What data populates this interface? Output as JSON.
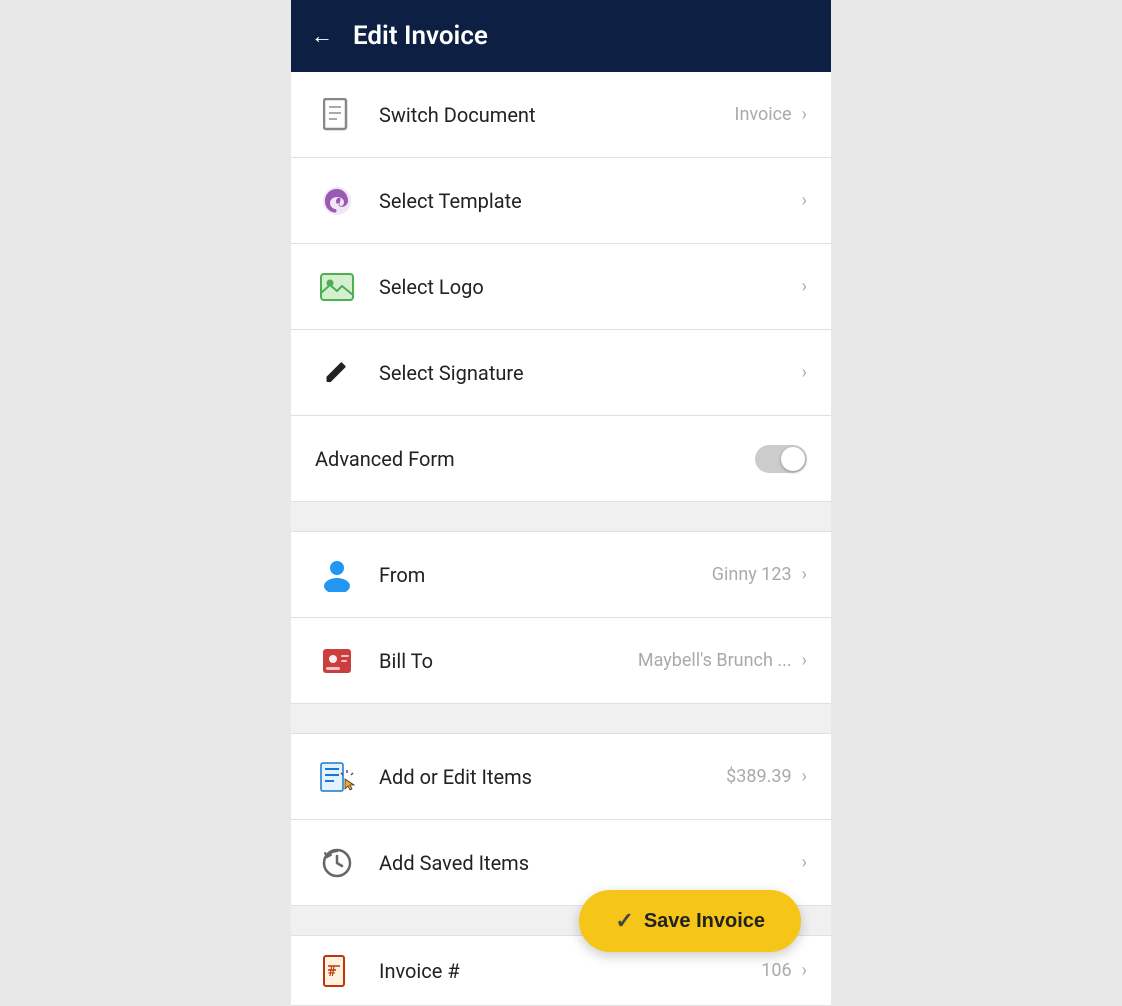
{
  "header": {
    "title": "Edit Invoice",
    "back_label": "←"
  },
  "menu_items": [
    {
      "id": "switch-document",
      "label": "Switch Document",
      "value": "Invoice",
      "icon": "document-icon",
      "has_chevron": true
    },
    {
      "id": "select-template",
      "label": "Select Template",
      "value": "",
      "icon": "palette-icon",
      "has_chevron": true
    },
    {
      "id": "select-logo",
      "label": "Select Logo",
      "value": "",
      "icon": "image-icon",
      "has_chevron": true
    },
    {
      "id": "select-signature",
      "label": "Select Signature",
      "value": "",
      "icon": "pencil-icon",
      "has_chevron": true
    }
  ],
  "advanced_form": {
    "label": "Advanced Form",
    "toggle_state": false
  },
  "section2_items": [
    {
      "id": "from",
      "label": "From",
      "value": "Ginny 123",
      "icon": "person-icon",
      "has_chevron": true
    },
    {
      "id": "bill-to",
      "label": "Bill To",
      "value": "Maybell's Brunch ...",
      "icon": "contact-card-icon",
      "has_chevron": true
    }
  ],
  "section3_items": [
    {
      "id": "add-edit-items",
      "label": "Add or Edit Items",
      "value": "$389.39",
      "icon": "list-cursor-icon",
      "has_chevron": true
    },
    {
      "id": "add-saved-items",
      "label": "Add Saved Items",
      "value": "",
      "icon": "history-icon",
      "has_chevron": true
    }
  ],
  "save_button": {
    "label": "Save Invoice",
    "check": "✓"
  },
  "invoice_num": {
    "label": "Invoice #",
    "value": "106",
    "icon": "invoice-num-icon"
  }
}
